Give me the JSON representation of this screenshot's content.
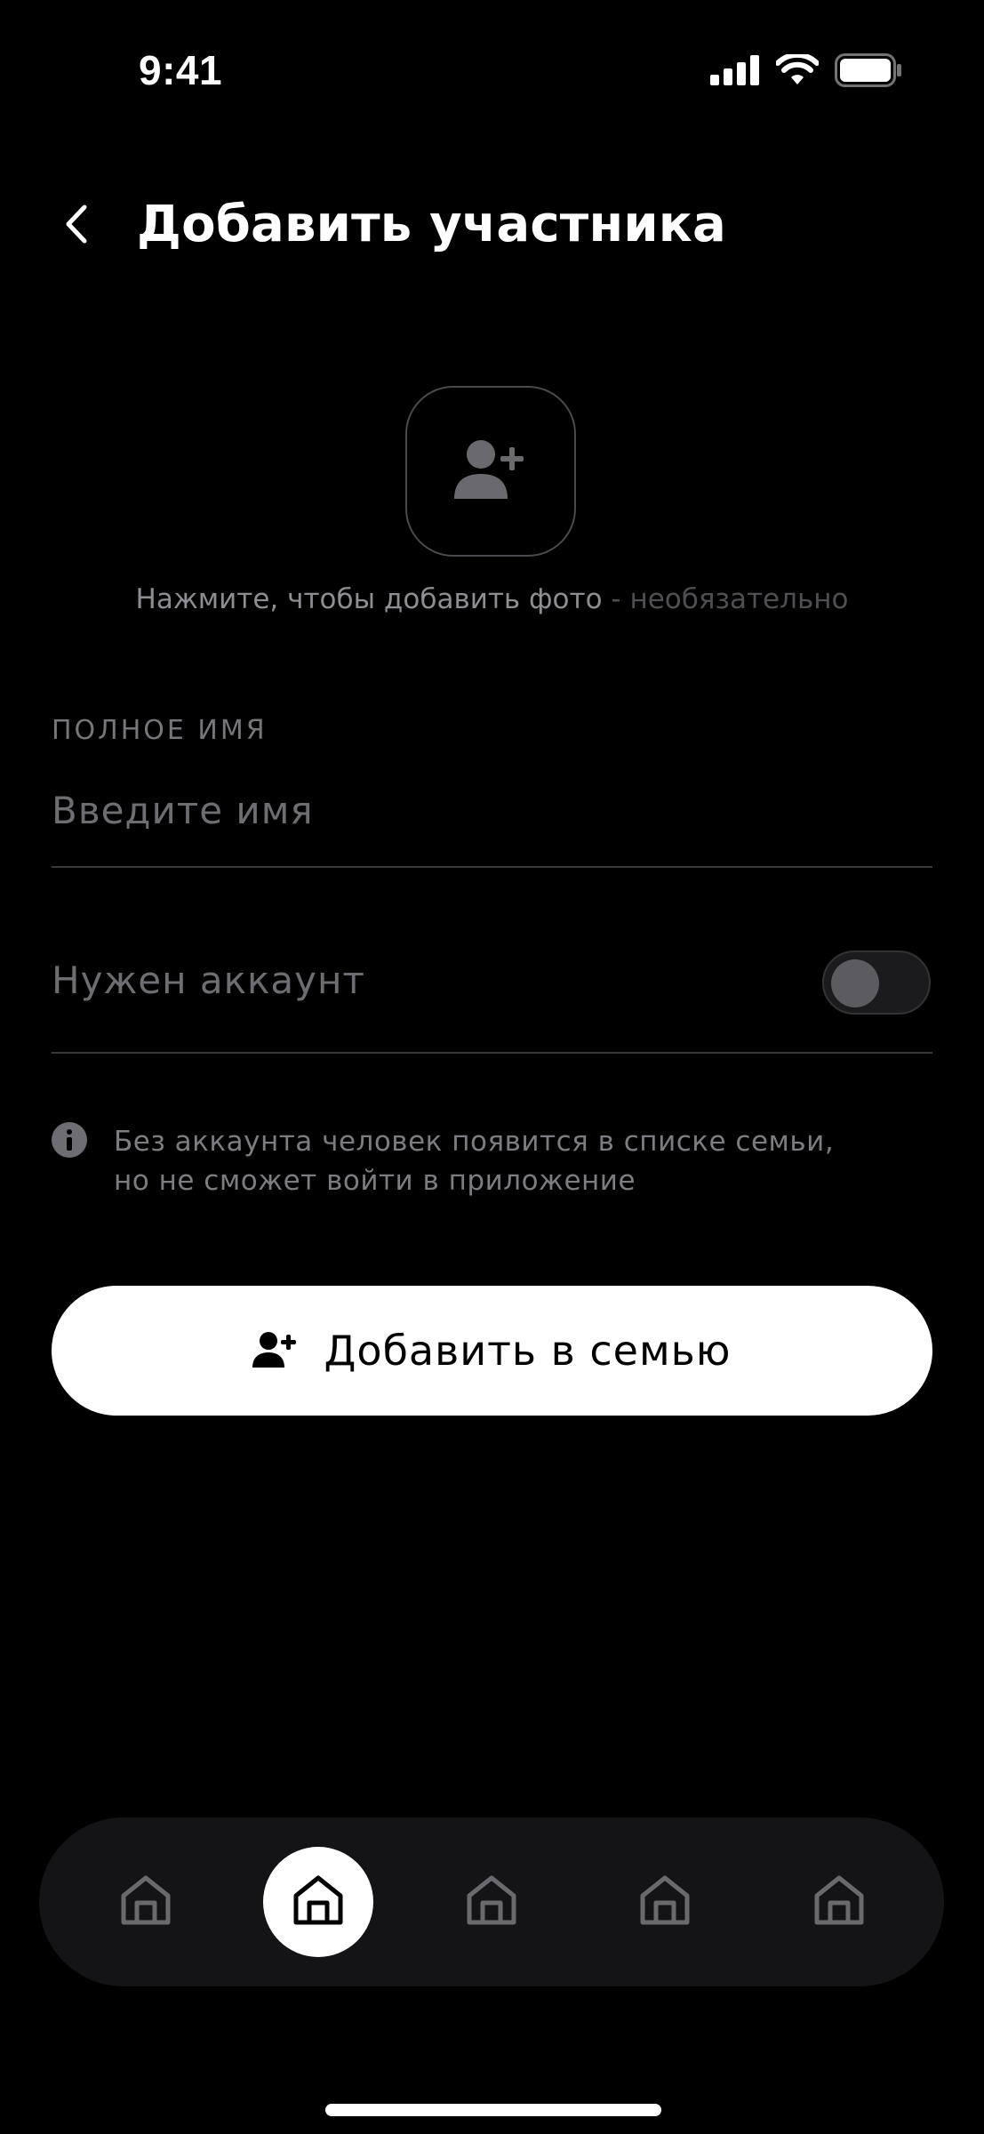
{
  "status_bar": {
    "time": "9:41"
  },
  "header": {
    "title": "Добавить участника"
  },
  "photo": {
    "hint": "Нажмите, чтобы добавить фото",
    "hint_optional": " - необязательно"
  },
  "name_field": {
    "label": "ПОЛНОЕ ИМЯ",
    "placeholder": "Введите имя",
    "value": ""
  },
  "account": {
    "label": "Нужен аккаунт",
    "enabled": false
  },
  "info": {
    "line1": "Без аккаунта человек появится в списке семьи,",
    "line2": "но не сможет войти в приложение"
  },
  "primary_button": {
    "label": "Добавить в семью"
  },
  "tab_bar": {
    "items": [
      {
        "icon": "home-icon",
        "active": false
      },
      {
        "icon": "home-icon",
        "active": true
      },
      {
        "icon": "home-icon",
        "active": false
      },
      {
        "icon": "home-icon",
        "active": false
      },
      {
        "icon": "home-icon",
        "active": false
      }
    ]
  },
  "colors": {
    "background": "#000000",
    "primary_button": "#ffffff",
    "tab_bar": "#141417",
    "muted_text": "#8d8d92"
  }
}
